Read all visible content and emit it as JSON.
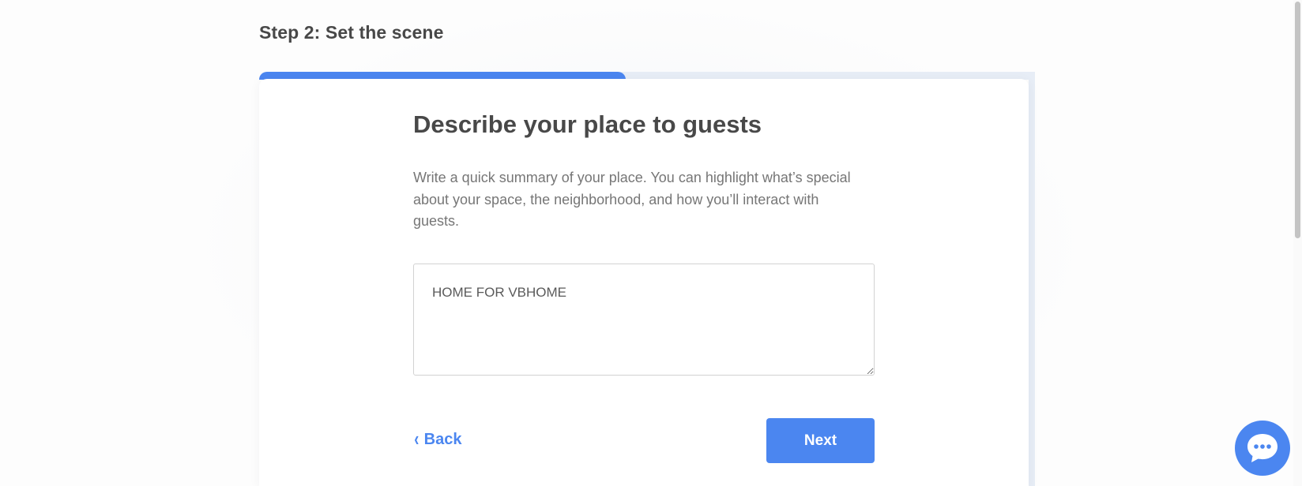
{
  "step": {
    "title": "Step 2: Set the scene",
    "progress": 0.5
  },
  "card": {
    "heading": "Describe your place to guests",
    "description": "Write a quick summary of your place. You can highlight what’s special about your space, the neighborhood, and how you’ll interact with guests.",
    "summary_value": "HOME FOR VBHOME"
  },
  "nav": {
    "back_label": "Back",
    "next_label": "Next"
  },
  "icons": {
    "back": "chevron-left-icon",
    "chat": "chat-bubble-icon"
  },
  "colors": {
    "accent": "#4b86f0",
    "heading": "#484848",
    "body_text": "#767676",
    "track": "#e7edf6"
  }
}
